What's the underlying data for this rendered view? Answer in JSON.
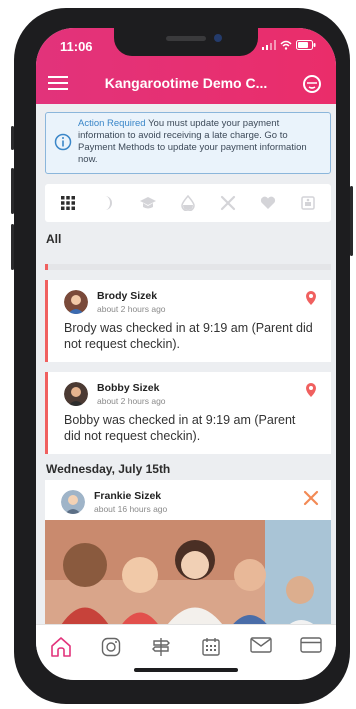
{
  "status_bar": {
    "time": "11:06"
  },
  "header": {
    "title": "Kangarootime Demo C..."
  },
  "alert": {
    "title": "Action Required",
    "message": "You must update your payment information to avoid receiving a late charge. Go to Payment Methods to update your payment information now."
  },
  "filters": {
    "section_label": "All",
    "icons": [
      "grid-icon",
      "moon-icon",
      "graduation-cap-icon",
      "droplet-icon",
      "utensils-icon",
      "heart-icon",
      "photo-icon"
    ]
  },
  "feed": {
    "items": [
      {
        "author": "Brody Sizek",
        "time_ago": "about 2 hours ago",
        "text": "Brody was checked in at 9:19 am (Parent did not request checkin).",
        "icon": "location-pin-icon"
      },
      {
        "author": "Bobby Sizek",
        "time_ago": "about 2 hours ago",
        "text": "Bobby was checked in at 9:19 am (Parent did not request checkin).",
        "icon": "location-pin-icon"
      }
    ],
    "date_header": "Wednesday, July 15th",
    "photo_post": {
      "author": "Frankie Sizek",
      "time_ago": "about 16 hours ago",
      "icon": "utensils-icon"
    }
  },
  "bottom_nav": [
    "home-icon",
    "instagram-icon",
    "signpost-icon",
    "calendar-icon",
    "mail-icon",
    "credit-card-icon"
  ],
  "colors": {
    "brand": "#e2337b",
    "accent": "#f0605f",
    "info": "#3a86c8",
    "meal": "#f28a55"
  }
}
